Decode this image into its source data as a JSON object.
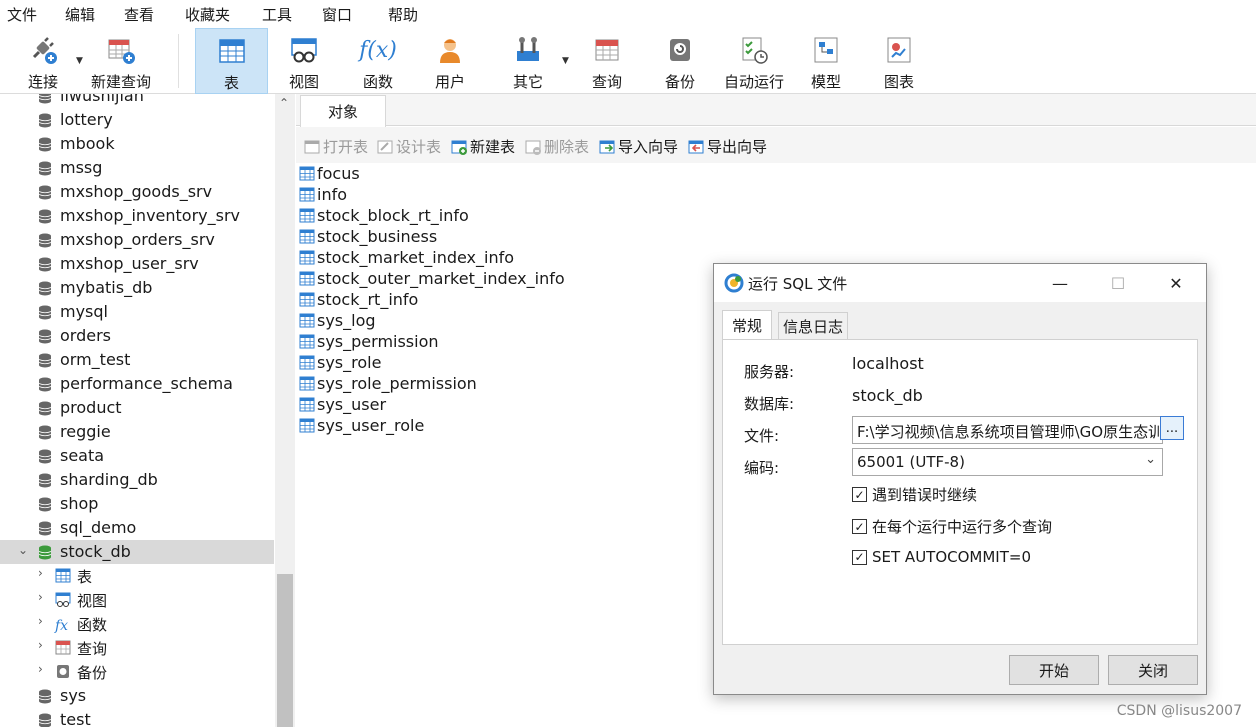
{
  "menu": [
    "文件",
    "编辑",
    "查看",
    "收藏夹",
    "工具",
    "窗口",
    "帮助"
  ],
  "toolbar": {
    "connect": "连接",
    "new_query": "新建查询",
    "table": "表",
    "view": "视图",
    "function": "函数",
    "user": "用户",
    "other": "其它",
    "query": "查询",
    "backup": "备份",
    "auto_run": "自动运行",
    "model": "模型",
    "chart": "图表"
  },
  "tree": {
    "databases_top": [
      "liwushijian",
      "lottery",
      "mbook",
      "mssg",
      "mxshop_goods_srv",
      "mxshop_inventory_srv",
      "mxshop_orders_srv",
      "mxshop_user_srv",
      "mybatis_db",
      "mysql",
      "orders",
      "orm_test",
      "performance_schema",
      "product",
      "reggie",
      "seata",
      "sharding_db",
      "shop",
      "sql_demo"
    ],
    "selected_db": "stock_db",
    "children": [
      "表",
      "视图",
      "函数",
      "查询",
      "备份"
    ],
    "databases_bottom": [
      "sys",
      "test"
    ]
  },
  "objects": {
    "tab": "对象",
    "actions": {
      "open_table": "打开表",
      "design_table": "设计表",
      "new_table": "新建表",
      "delete_table": "删除表",
      "import_wizard": "导入向导",
      "export_wizard": "导出向导"
    },
    "tables": [
      "focus",
      "info",
      "stock_block_rt_info",
      "stock_business",
      "stock_market_index_info",
      "stock_outer_market_index_info",
      "stock_rt_info",
      "sys_log",
      "sys_permission",
      "sys_role",
      "sys_role_permission",
      "sys_user",
      "sys_user_role"
    ]
  },
  "dialog": {
    "title": "运行 SQL 文件",
    "tabs": [
      "常规",
      "信息日志"
    ],
    "server_label": "服务器:",
    "server_value": "localhost",
    "database_label": "数据库:",
    "database_value": "stock_db",
    "file_label": "文件:",
    "file_value": "F:\\学习视频\\信息系统项目管理师\\GO原生态训",
    "browse": "...",
    "encoding_label": "编码:",
    "encoding_value": "65001 (UTF-8)",
    "options": [
      {
        "label": "遇到错误时继续",
        "checked": true
      },
      {
        "label": "在每个运行中运行多个查询",
        "checked": true
      },
      {
        "label": "SET AUTOCOMMIT=0",
        "checked": true
      }
    ],
    "start": "开始",
    "close": "关闭"
  },
  "watermark": "CSDN @lisus2007"
}
